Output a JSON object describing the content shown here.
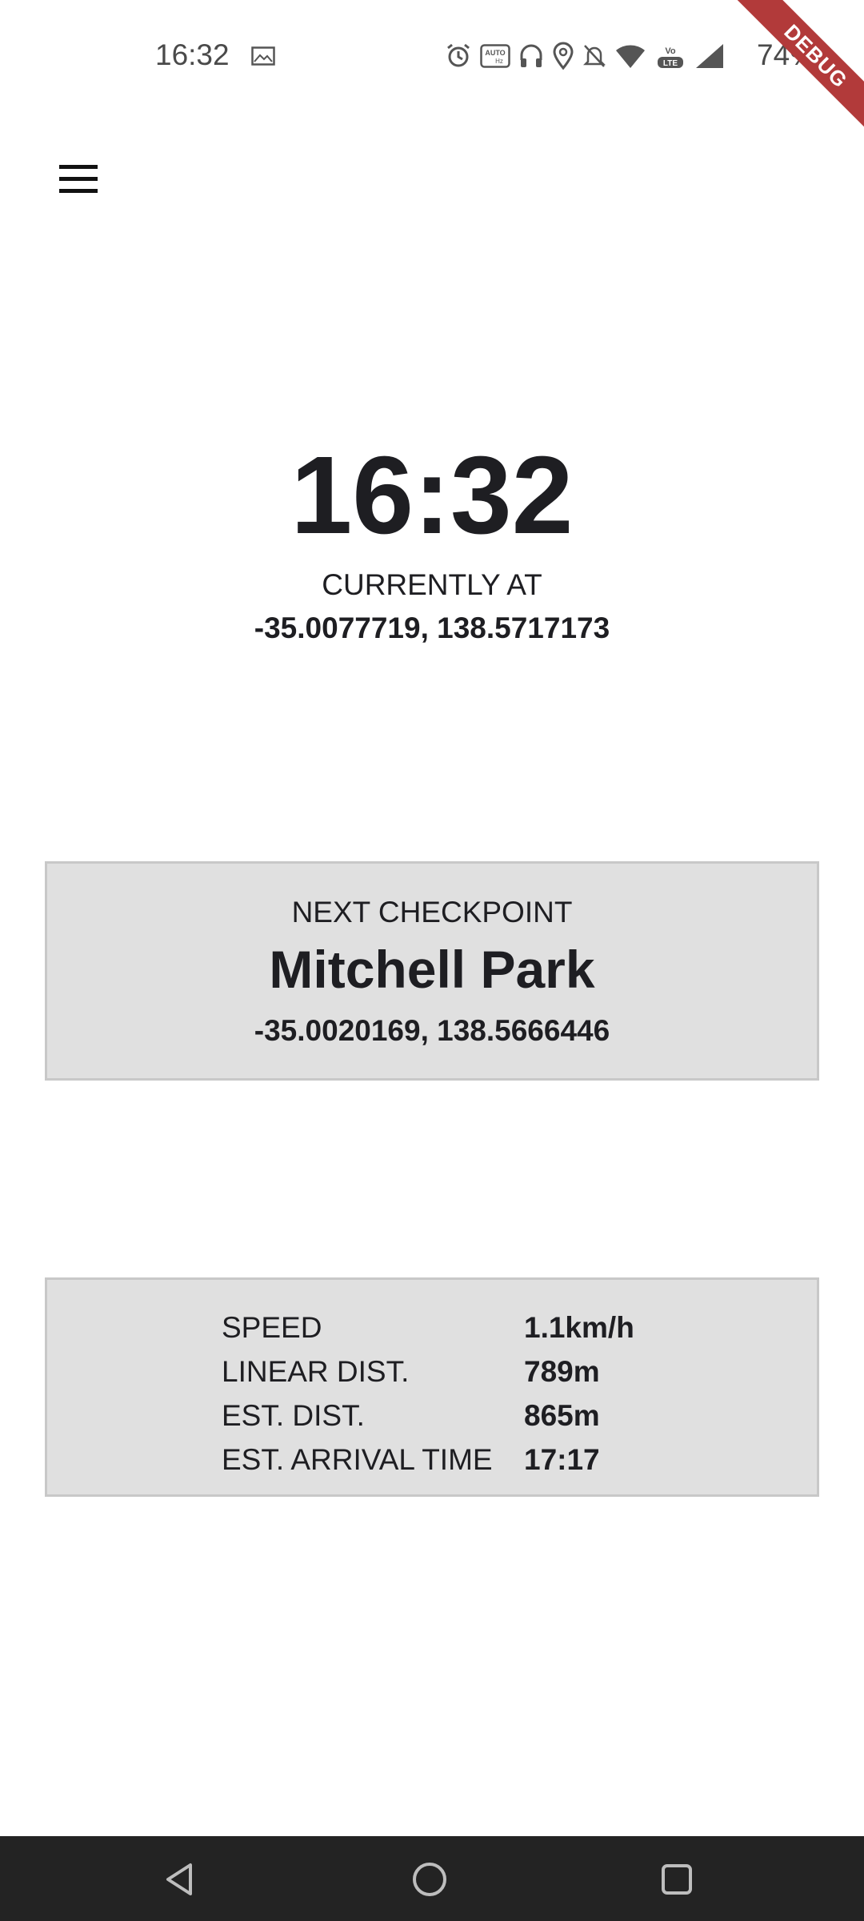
{
  "status_bar": {
    "time": "16:32",
    "battery": "74%",
    "icons": [
      "image-icon",
      "alarm-icon",
      "auto-hz-icon",
      "headphones-icon",
      "location-icon",
      "notifications-off-icon",
      "wifi-icon",
      "volte-icon",
      "signal-icon"
    ]
  },
  "debug_banner": "DEBUG",
  "clock": "16:32",
  "current_location": {
    "label": "CURRENTLY AT",
    "coords": "-35.0077719, 138.5717173"
  },
  "next_checkpoint": {
    "label": "NEXT CHECKPOINT",
    "name": "Mitchell Park",
    "coords": "-35.0020169, 138.5666446"
  },
  "stats": [
    {
      "label": "SPEED",
      "value": "1.1km/h"
    },
    {
      "label": "LINEAR DIST.",
      "value": "789m"
    },
    {
      "label": "EST. DIST.",
      "value": "865m"
    },
    {
      "label": "EST. ARRIVAL TIME",
      "value": "17:17"
    }
  ],
  "nav": [
    "back-icon",
    "home-icon",
    "recents-icon"
  ]
}
